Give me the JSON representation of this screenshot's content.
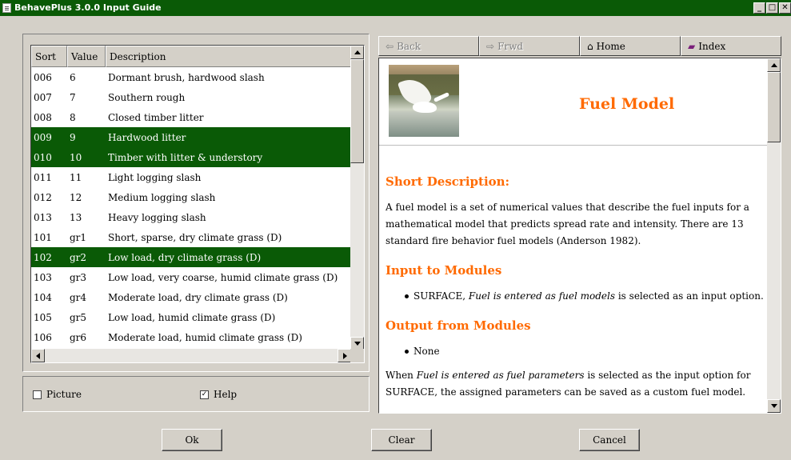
{
  "window": {
    "title": "BehavePlus 3.0.0 Input Guide"
  },
  "list": {
    "headers": [
      "Sort",
      "Value",
      "Description"
    ],
    "rows": [
      {
        "sort": "006",
        "value": "6",
        "desc": "Dormant brush, hardwood slash",
        "selected": false
      },
      {
        "sort": "007",
        "value": "7",
        "desc": "Southern rough",
        "selected": false
      },
      {
        "sort": "008",
        "value": "8",
        "desc": "Closed timber litter",
        "selected": false
      },
      {
        "sort": "009",
        "value": "9",
        "desc": "Hardwood litter",
        "selected": true
      },
      {
        "sort": "010",
        "value": "10",
        "desc": "Timber with litter & understory",
        "selected": true
      },
      {
        "sort": "011",
        "value": "11",
        "desc": "Light logging slash",
        "selected": false
      },
      {
        "sort": "012",
        "value": "12",
        "desc": "Medium logging slash",
        "selected": false
      },
      {
        "sort": "013",
        "value": "13",
        "desc": "Heavy logging slash",
        "selected": false
      },
      {
        "sort": "101",
        "value": "gr1",
        "desc": "Short, sparse, dry climate grass (D)",
        "selected": false
      },
      {
        "sort": "102",
        "value": "gr2",
        "desc": "Low load, dry climate grass (D)",
        "selected": true
      },
      {
        "sort": "103",
        "value": "gr3",
        "desc": "Low load, very coarse, humid climate grass (D)",
        "selected": false
      },
      {
        "sort": "104",
        "value": "gr4",
        "desc": "Moderate load, dry climate grass (D)",
        "selected": false
      },
      {
        "sort": "105",
        "value": "gr5",
        "desc": "Low load, humid climate grass (D)",
        "selected": false
      },
      {
        "sort": "106",
        "value": "gr6",
        "desc": "Moderate load, humid climate grass (D)",
        "selected": false
      }
    ]
  },
  "options": {
    "picture_label": "Picture",
    "picture_checked": false,
    "help_label": "Help",
    "help_checked": true
  },
  "nav": {
    "back": "Back",
    "forward": "Frwd",
    "home": "Home",
    "index": "Index"
  },
  "help": {
    "title": "Fuel Model",
    "short_desc_heading": "Short Description:",
    "short_desc_text": "A fuel model is a set of numerical values that describe the fuel inputs for a mathematical model that predicts spread rate and intensity. There are 13 standard fire behavior fuel models (Anderson 1982).",
    "input_heading": "Input to Modules",
    "input_bullet_prefix": "SURFACE, ",
    "input_bullet_italic": "Fuel is entered as fuel models",
    "input_bullet_suffix": " is selected as an input option.",
    "output_heading": "Output from Modules",
    "output_bullet": "None",
    "para_prefix": "When ",
    "para_italic": "Fuel is entered as fuel parameters",
    "para_suffix": " is selected as the input option for SURFACE, the assigned parameters can be saved as a custom fuel model."
  },
  "buttons": {
    "ok": "Ok",
    "clear": "Clear",
    "cancel": "Cancel"
  },
  "colors": {
    "selection": "#0a5a06",
    "heading": "#ff6a00"
  }
}
